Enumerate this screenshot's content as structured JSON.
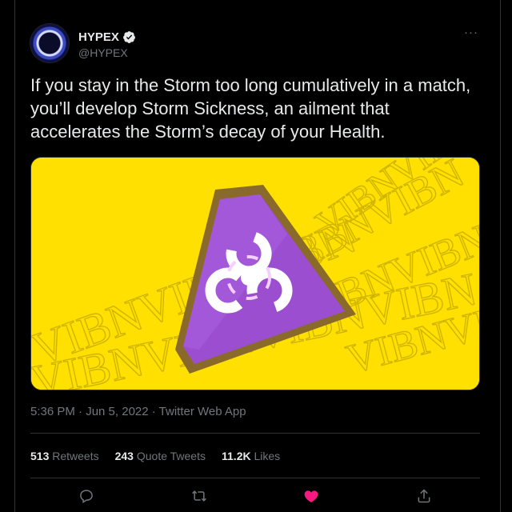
{
  "tweet": {
    "author_name": "HYPEX",
    "author_handle": "@HYPEX",
    "more_label": "···",
    "text": "If you stay in the Storm too long cumulatively in a match, you’ll develop Storm Sickness, an ailment that accelerates the Storm’s decay of your Health.",
    "timestamp": "5:36 PM · Jun 5, 2022 · Twitter Web App",
    "media": {
      "background_color": "#ffe000",
      "icon": "biohazard-icon",
      "pattern_text": "VIBN"
    },
    "stats": [
      {
        "count": "513",
        "label": "Retweets"
      },
      {
        "count": "243",
        "label": "Quote Tweets"
      },
      {
        "count": "11.2K",
        "label": "Likes"
      }
    ],
    "actions": [
      {
        "icon": "reply-icon"
      },
      {
        "icon": "retweet-icon"
      },
      {
        "icon": "like-icon",
        "color": "#f91880"
      },
      {
        "icon": "share-icon"
      }
    ]
  },
  "colors": {
    "background": "#000000",
    "text_primary": "#e7e9ea",
    "text_secondary": "#71767b",
    "accent": "#1d9bf0",
    "like": "#f91880"
  }
}
